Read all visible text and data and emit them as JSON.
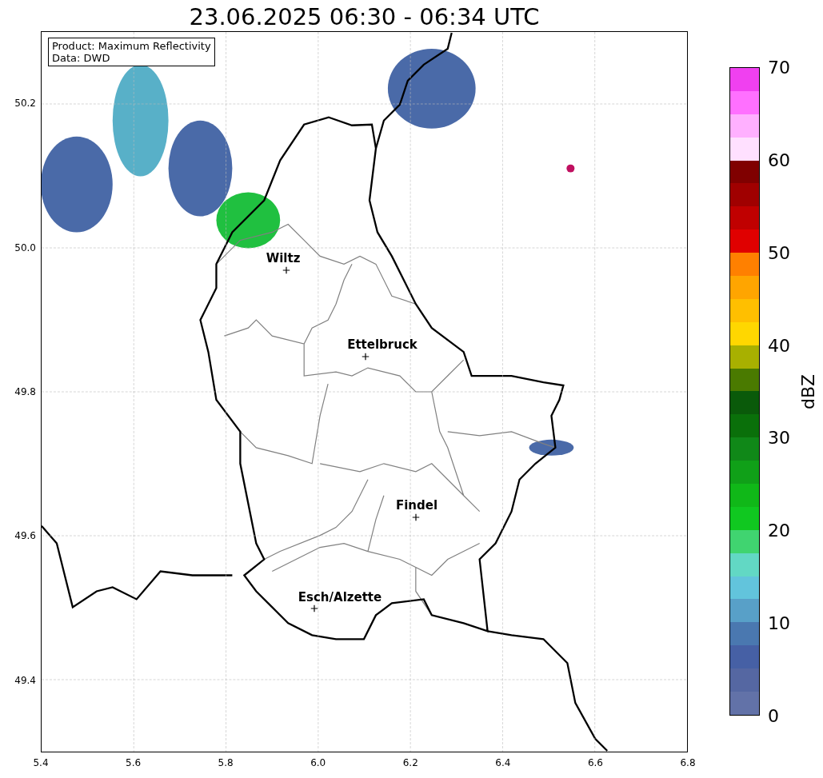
{
  "title": "23.06.2025 06:30 - 06:34 UTC",
  "info_box": {
    "lines": [
      "Product: Maximum Reflectivity",
      "Data: DWD"
    ]
  },
  "map": {
    "cities": [
      {
        "name": "Wiltz"
      },
      {
        "name": "Ettelbruck"
      },
      {
        "name": "Findel"
      },
      {
        "name": "Esch/Alzette"
      }
    ],
    "x_ticks": [
      "5.4",
      "5.6",
      "5.8",
      "6.0",
      "6.2",
      "6.4",
      "6.6",
      "6.8"
    ],
    "y_ticks": [
      "50.2",
      "50.0",
      "49.8",
      "49.6",
      "49.4"
    ]
  },
  "colorbar": {
    "label": "dBZ",
    "ticks": [
      "70",
      "60",
      "50",
      "40",
      "30",
      "20",
      "10",
      "0"
    ],
    "segments": [
      {
        "color": "#f040f0"
      },
      {
        "color": "#ff70ff"
      },
      {
        "color": "#ffb0ff"
      },
      {
        "color": "#ffe0ff"
      },
      {
        "color": "#800000"
      },
      {
        "color": "#a00000"
      },
      {
        "color": "#c00000"
      },
      {
        "color": "#e00000"
      },
      {
        "color": "#ff8000"
      },
      {
        "color": "#ffa500"
      },
      {
        "color": "#ffbf00"
      },
      {
        "color": "#ffd700"
      },
      {
        "color": "#a8b000"
      },
      {
        "color": "#4a7a00"
      },
      {
        "color": "#0a5a0a"
      },
      {
        "color": "#0a700a"
      },
      {
        "color": "#108818"
      },
      {
        "color": "#10a018"
      },
      {
        "color": "#10b818"
      },
      {
        "color": "#10c820"
      },
      {
        "color": "#40d470"
      },
      {
        "color": "#62d8c4"
      },
      {
        "color": "#62c4dc"
      },
      {
        "color": "#58a0c8"
      },
      {
        "color": "#4a78b0"
      },
      {
        "color": "#4660a5"
      },
      {
        "color": "#5567a2"
      },
      {
        "color": "#6272a8"
      }
    ]
  }
}
